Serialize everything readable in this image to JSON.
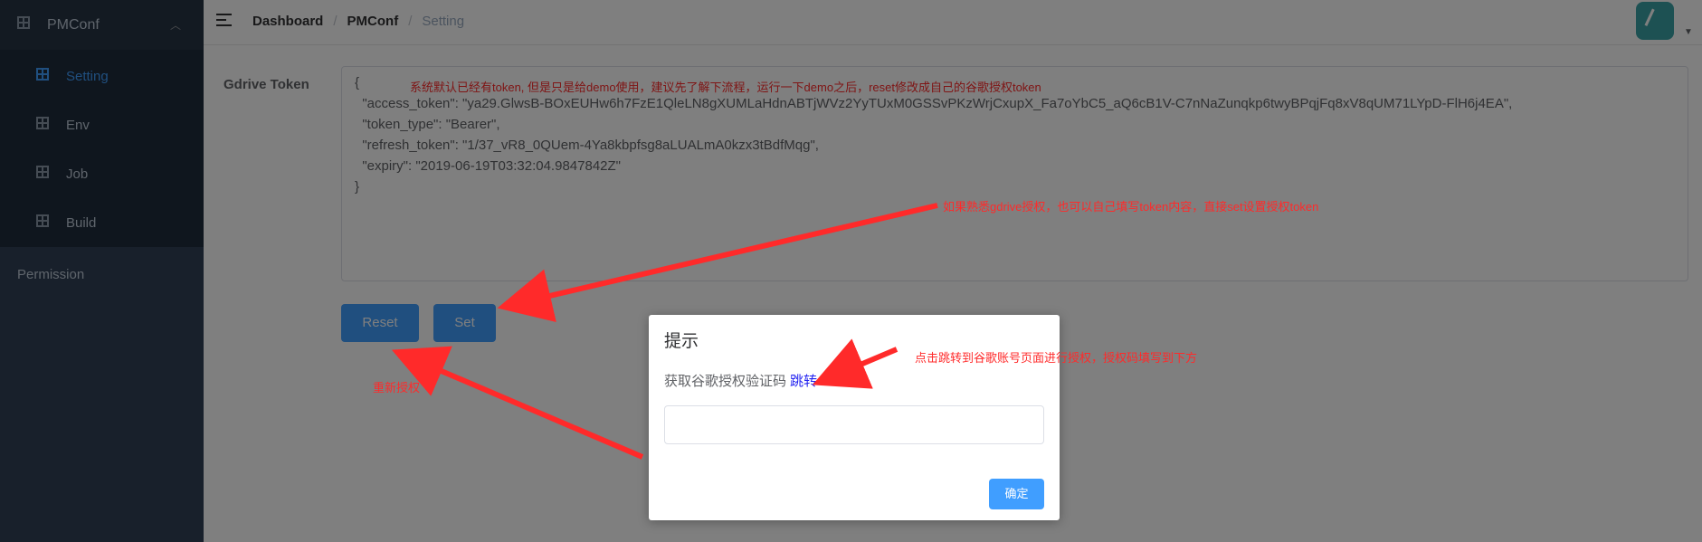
{
  "sidebar": {
    "header_title": "PMConf",
    "items": [
      {
        "label": "Setting",
        "active": true
      },
      {
        "label": "Env",
        "active": false
      },
      {
        "label": "Job",
        "active": false
      },
      {
        "label": "Build",
        "active": false
      }
    ],
    "permission_label": "Permission"
  },
  "navbar": {
    "breadcrumb": [
      "Dashboard",
      "PMConf",
      "Setting"
    ]
  },
  "form": {
    "label": "Gdrive Token",
    "token_text": "{\n  \"access_token\": \"ya29.GlwsB-BOxEUHw6h7FzE1QleLN8gXUMLaHdnABTjWVz2YyTUxM0GSSvPKzWrjCxupX_Fa7oYbC5_aQ6cB1V-C7nNaZunqkp6twyBPqjFq8xV8qUM71LYpD-FlH6j4EA\",\n  \"token_type\": \"Bearer\",\n  \"refresh_token\": \"1/37_vR8_0QUem-4Ya8kbpfsg8aLUALmA0kzx3tBdfMqg\",\n  \"expiry\": \"2019-06-19T03:32:04.9847842Z\"\n}",
    "reset_label": "Reset",
    "set_label": "Set"
  },
  "dialog": {
    "title": "提示",
    "message": "获取谷歌授权验证码",
    "link_label": "跳转",
    "input_value": "",
    "ok_label": "确定"
  },
  "annotations": {
    "top_note": "系统默认已经有token, 但是只是给demo使用，建议先了解下流程，运行一下demo之后，reset修改成自己的谷歌授权token",
    "set_note": "如果熟悉gdrive授权，也可以自己填写token内容，直接set设置授权token",
    "link_note": "点击跳转到谷歌账号页面进行授权，授权码填写到下方",
    "reset_note": "重新授权"
  },
  "colors": {
    "sidebar_bg": "#304156",
    "accent": "#409eff",
    "annotation": "#ff2a2a"
  }
}
